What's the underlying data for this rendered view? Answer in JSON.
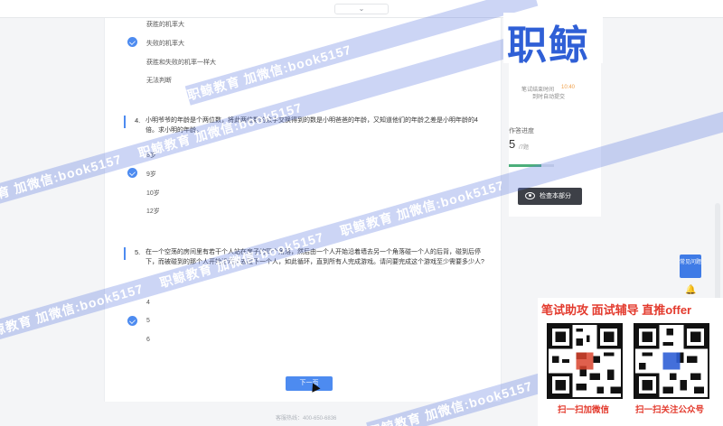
{
  "topbar": {
    "toggle": "⌄"
  },
  "question3": {
    "options": [
      {
        "text": "获胜的机率大",
        "checked": false
      },
      {
        "text": "失败的机率大",
        "checked": true
      },
      {
        "text": "获胜和失败的机率一样大",
        "checked": false
      },
      {
        "text": "无法判断",
        "checked": false
      }
    ]
  },
  "question4": {
    "number": "4.",
    "text": "小明爷爷的年龄是个两位数，将此两位数的数字交换得到的数是小明爸爸的年龄，又知道他们的年龄之差是小明年龄的4倍。求小明的年龄。",
    "options": [
      {
        "text": "8岁",
        "checked": false
      },
      {
        "text": "9岁",
        "checked": true
      },
      {
        "text": "10岁",
        "checked": false
      },
      {
        "text": "12岁",
        "checked": false
      }
    ]
  },
  "question5": {
    "number": "5.",
    "text": "在一个空荡的房间里有若干个人站在房子的四个角落，然后由一个人开始沿着墙去另一个角落碰一个人的后背，碰到后停下，而被碰到的那个人开始沿墙走去碰下一个人，如此循环，直到所有人完成游戏。请问要完成这个游戏至少需要多少人?",
    "options": [
      {
        "text": "4",
        "checked": false
      },
      {
        "text": "5",
        "checked": true
      },
      {
        "text": "6",
        "checked": false
      }
    ]
  },
  "next_button": "下一页",
  "footer": "客服热线：400-650-6836",
  "right_panel": {
    "timer_label": "笔试结束时间",
    "timer_value": "10:40",
    "timer_sub": "到时自动提交",
    "progress_label": "作答进度",
    "progress_count": "5",
    "progress_total": "/7题",
    "progress_fraction": 0.71,
    "check_button": "检查本部分"
  },
  "feedback_button": "常见问题",
  "watermark": {
    "logo": "职鲸",
    "band_text": "职鲸教育 加微信:book5157",
    "band_text_short": "book5157"
  },
  "promo": {
    "headline": "笔试助攻  面试辅导  直推offer",
    "caption_left": "扫一扫加微信",
    "caption_right": "扫一扫关注公众号"
  },
  "colors": {
    "accent": "#4d8bf0",
    "promo_red": "#e33a2d",
    "logo_blue": "#2f5fd6"
  }
}
